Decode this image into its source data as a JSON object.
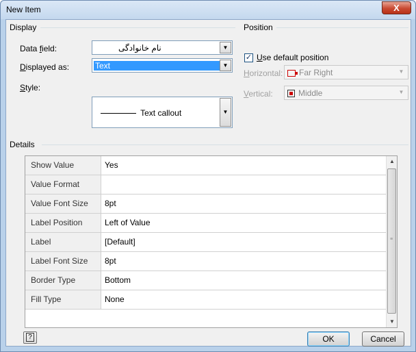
{
  "window": {
    "title": "New Item",
    "close_label": "X"
  },
  "display": {
    "group_label": "Display",
    "data_field": {
      "label": "Data field:",
      "value": "نام خانوادگی"
    },
    "displayed_as": {
      "label": "Displayed as:",
      "value": "Text"
    },
    "style": {
      "label": "Style:",
      "value": "Text callout"
    }
  },
  "position": {
    "group_label": "Position",
    "use_default": {
      "label": "Use default position",
      "checked": true
    },
    "horizontal": {
      "label": "Horizontal:",
      "value": "Far Right"
    },
    "vertical": {
      "label": "Vertical:",
      "value": "Middle"
    }
  },
  "details": {
    "group_label": "Details",
    "rows": [
      {
        "key": "Show Value",
        "value": "Yes"
      },
      {
        "key": "Value Format",
        "value": ""
      },
      {
        "key": "Value Font Size",
        "value": "8pt"
      },
      {
        "key": "Label Position",
        "value": "Left of Value"
      },
      {
        "key": "Label",
        "value": "[Default]"
      },
      {
        "key": "Label Font Size",
        "value": "8pt"
      },
      {
        "key": "Border Type",
        "value": "Bottom"
      },
      {
        "key": "Fill Type",
        "value": "None"
      }
    ]
  },
  "buttons": {
    "ok": "OK",
    "cancel": "Cancel"
  },
  "icons": {
    "help": "help-icon",
    "far_right": "far-right-position-icon",
    "middle": "middle-position-icon",
    "dropdown": "chevron-down-icon"
  },
  "colors": {
    "title_bar": "#c4d8ee",
    "close_button": "#c94a32",
    "selection": "#3399ff"
  }
}
